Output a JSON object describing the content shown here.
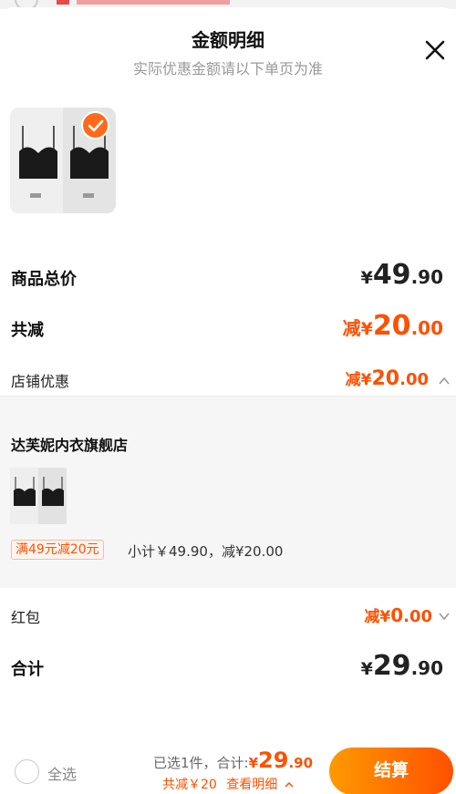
{
  "header": {
    "title": "金额明细",
    "subtitle": "实际优惠金额请以下单页为准"
  },
  "icons": {
    "close": "close-icon",
    "selected_check": "check-icon",
    "expand_up": "chevron-up-icon",
    "expand_down": "chevron-down-icon"
  },
  "summary": {
    "total_label": "商品总价",
    "total_yen": "¥",
    "total_int": "49",
    "total_dec": ".90",
    "discount_label": "共减",
    "discount_prefix": "减",
    "discount_yen": "¥",
    "discount_int": "20",
    "discount_dec": ".00",
    "store_label": "店铺优惠",
    "store_prefix": "减",
    "store_yen": "¥",
    "store_int": "20",
    "store_dec": ".00"
  },
  "shop": {
    "name": "达芙妮内衣旗舰店",
    "promo_tag": "满49元减20元",
    "subtotal": "小计￥49.90，减¥20.00"
  },
  "redpacket": {
    "label": "红包",
    "prefix": "减",
    "yen": "¥",
    "int": "0",
    "dec": ".00"
  },
  "grand_total": {
    "label": "合计",
    "yen": "¥",
    "int": "29",
    "dec": ".90"
  },
  "footer": {
    "select_all": "全选",
    "selected_text": "已选1件，合计:",
    "total_yen": "¥",
    "total_int": "29",
    "total_dec": ".90",
    "saved_text": "共减￥20",
    "detail_link": "查看明细",
    "checkout": "结算"
  },
  "colors": {
    "accent": "#ff5000",
    "gradient_start": "#ff9a00"
  }
}
